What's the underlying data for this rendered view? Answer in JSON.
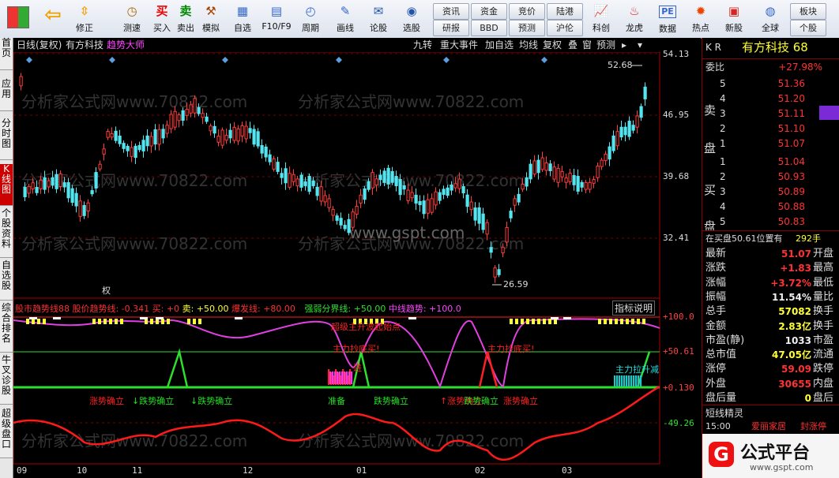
{
  "toolbar": {
    "buttons": [
      {
        "label": "",
        "icon": "app-icon"
      },
      {
        "label": "",
        "icon": "back-arrow-icon"
      },
      {
        "label": "修正",
        "icon": "up-down-arrow-icon"
      },
      {
        "label": "测速",
        "icon": "clock-icon"
      },
      {
        "label": "买入",
        "icon": "buy-icon",
        "glyph": "买"
      },
      {
        "label": "卖出",
        "icon": "sell-icon",
        "glyph": "卖"
      },
      {
        "label": "模拟",
        "icon": "hammer-icon"
      },
      {
        "label": "自选",
        "icon": "watchlist-icon"
      },
      {
        "label": "F10/F9",
        "icon": "f10-icon"
      },
      {
        "label": "周期",
        "icon": "period-icon"
      },
      {
        "label": "画线",
        "icon": "pencil-icon"
      },
      {
        "label": "论股",
        "icon": "discuss-icon"
      },
      {
        "label": "选股",
        "icon": "stock-pick-icon"
      }
    ],
    "small_buttons": [
      "资讯",
      "资金",
      "竞价",
      "陆港",
      "研报",
      "BBD",
      "预测",
      "沪伦"
    ],
    "right_buttons": [
      {
        "label": "科创",
        "icon": "chart-icon"
      },
      {
        "label": "龙虎",
        "icon": "dragon-tiger-icon"
      },
      {
        "label": "数据",
        "icon": "pe-icon"
      },
      {
        "label": "热点",
        "icon": "hot-icon"
      },
      {
        "label": "新股",
        "icon": "ipo-icon"
      },
      {
        "label": "全球",
        "icon": "globe-icon"
      },
      {
        "label": "板块",
        "icon": ""
      },
      {
        "label": "个股",
        "icon": ""
      }
    ]
  },
  "sidebar": {
    "tabs": [
      "首页",
      "应用",
      "分时图",
      "K线图",
      "个股资料",
      "自选股",
      "综合排名",
      "牛叉诊股",
      "超级盘口"
    ],
    "active_index": 3
  },
  "chart": {
    "header_left": [
      "日线(复权)",
      "有方科技",
      "趋势大师"
    ],
    "header_tabs": [
      "九转",
      "重大事件",
      "加自选",
      "均线",
      "复权",
      "叠",
      "窗",
      "预测"
    ],
    "price_ticks": [
      "54.13",
      "46.95",
      "39.68",
      "32.41"
    ],
    "high_label": "52.68",
    "low_label": "26.59",
    "watermark_url": "www.gspt.com",
    "watermark_text": "分析家公式网www.70822.com",
    "event_label": "权",
    "indicator_legend": {
      "name": "股市趋势线88",
      "items": [
        {
          "text": "股价趋势线: -0.341",
          "color": "#ff3030"
        },
        {
          "text": "买: +0",
          "color": "#ff3030"
        },
        {
          "text": "卖: +50.00",
          "color": "#ffff33"
        },
        {
          "text": "爆发线: +80.00",
          "color": "#ff3030"
        },
        {
          "text": "强弱分界线: +50.00",
          "color": "#2ee02e"
        },
        {
          "text": "中线趋势: +100.0",
          "color": "#ff44ff"
        }
      ]
    },
    "indicator_button": "指标说明",
    "indicator_ticks": [
      "+100.0",
      "+50.61",
      "+0.130",
      "-49.26"
    ],
    "annotations": [
      {
        "text": "超级主升波起始点",
        "color": "#ff2020"
      },
      {
        "text": "主力抄底买!",
        "color": "#ff2020"
      },
      {
        "text": "主力抄底买!",
        "color": "#ff2020"
      },
      {
        "text": "主力拉升减",
        "color": "#20e0e0"
      },
      {
        "text": "涨势确立",
        "color": "#ff2020"
      },
      {
        "text": "↓跌势确立",
        "color": "#20e020"
      },
      {
        "text": "↓跌势确立",
        "color": "#20e020"
      },
      {
        "text": "准备",
        "color": "#20e020"
      },
      {
        "text": "跌势确立",
        "color": "#20e020"
      },
      {
        "text": "↑涨势确立",
        "color": "#ff2020"
      },
      {
        "text": "跌势确立",
        "color": "#20e020"
      },
      {
        "text": "涨势确立",
        "color": "#ff2020"
      },
      {
        "text": "进",
        "color": "#ff2020"
      }
    ],
    "x_labels": [
      "09",
      "10",
      "11",
      "12",
      "01",
      "02",
      "03"
    ]
  },
  "quote": {
    "code": "K R",
    "name": "有方科技 68",
    "weibi_label": "委比",
    "weibi_value": "+27.98%",
    "sell_label": "卖盘",
    "buy_label": "买盘",
    "sell": [
      {
        "level": "5",
        "price": "51.36"
      },
      {
        "level": "4",
        "price": "51.20"
      },
      {
        "level": "3",
        "price": "51.11"
      },
      {
        "level": "2",
        "price": "51.10"
      },
      {
        "level": "1",
        "price": "51.07"
      }
    ],
    "buy": [
      {
        "level": "1",
        "price": "51.04"
      },
      {
        "level": "2",
        "price": "50.93"
      },
      {
        "level": "3",
        "price": "50.89"
      },
      {
        "level": "4",
        "price": "50.88"
      },
      {
        "level": "5",
        "price": "50.83"
      }
    ],
    "position_text": "在买盘50.61位置有",
    "position_vol": "292手",
    "stats": [
      {
        "label": "最新",
        "value": "51.07",
        "color": "#ff3333",
        "right": "开盘"
      },
      {
        "label": "涨跌",
        "value": "+1.83",
        "color": "#ff3333",
        "right": "最高"
      },
      {
        "label": "涨幅",
        "value": "+3.72%",
        "color": "#ff3333",
        "right": "最低"
      },
      {
        "label": "振幅",
        "value": "11.54%",
        "color": "#eeeeee",
        "right": "量比"
      },
      {
        "label": "总手",
        "value": "57082",
        "color": "#ffff33",
        "right": "换手"
      },
      {
        "label": "金额",
        "value": "2.83亿",
        "color": "#ffff33",
        "right": "换手"
      },
      {
        "label": "市盈(静)",
        "value": "1033",
        "color": "#eeeeee",
        "right": "市盈"
      },
      {
        "label": "总市值",
        "value": "47.05亿",
        "color": "#ffff33",
        "right": "流通"
      },
      {
        "label": "涨停",
        "value": "59.09",
        "color": "#ff3333",
        "right": "跌停"
      },
      {
        "label": "外盘",
        "value": "30655",
        "color": "#ff3333",
        "right": "内盘"
      },
      {
        "label": "盘后量",
        "value": "0",
        "color": "#ffff33",
        "right": "盘后"
      }
    ],
    "short_sprite_title": "短线精灵",
    "sprite_row": {
      "time": "15:00",
      "text1": "爱丽家居",
      "text2": "封涨停"
    },
    "brand": "公式平台",
    "brand_url": "www.gspt.com"
  }
}
